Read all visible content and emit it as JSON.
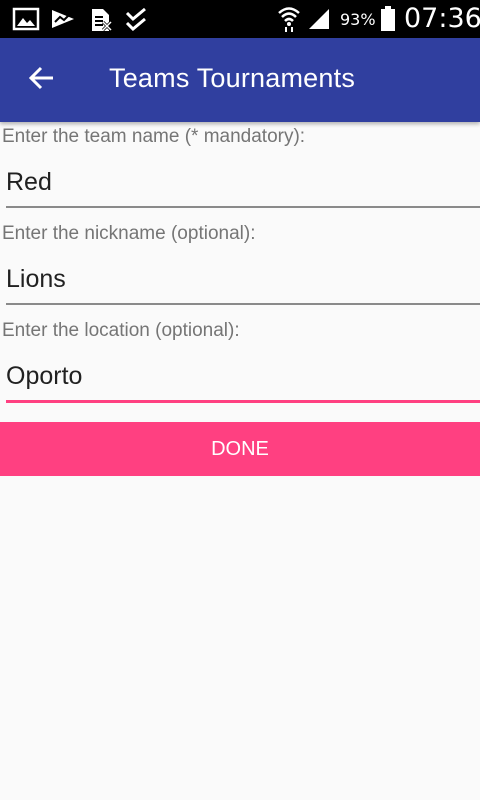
{
  "status_bar": {
    "left_icons": [
      "image-icon",
      "trending-icon",
      "sim-alert-icon",
      "check-all-icon"
    ],
    "right_icons": [
      "wifi-icon",
      "signal-icon",
      "battery-icon"
    ],
    "battery_percent": "93%",
    "time": "07:36"
  },
  "app_bar": {
    "back_icon": "arrow-left-icon",
    "title": "Teams Tournaments",
    "color": "#303f9f"
  },
  "form": {
    "team_name": {
      "label": "Enter the team name (* mandatory):",
      "value": "Red"
    },
    "nickname": {
      "label": "Enter the nickname (optional):",
      "value": "Lions"
    },
    "location": {
      "label": "Enter the location (optional):",
      "value": "Oporto",
      "focused": true
    }
  },
  "done_button": {
    "label": "DONE",
    "color": "#ff4081"
  }
}
